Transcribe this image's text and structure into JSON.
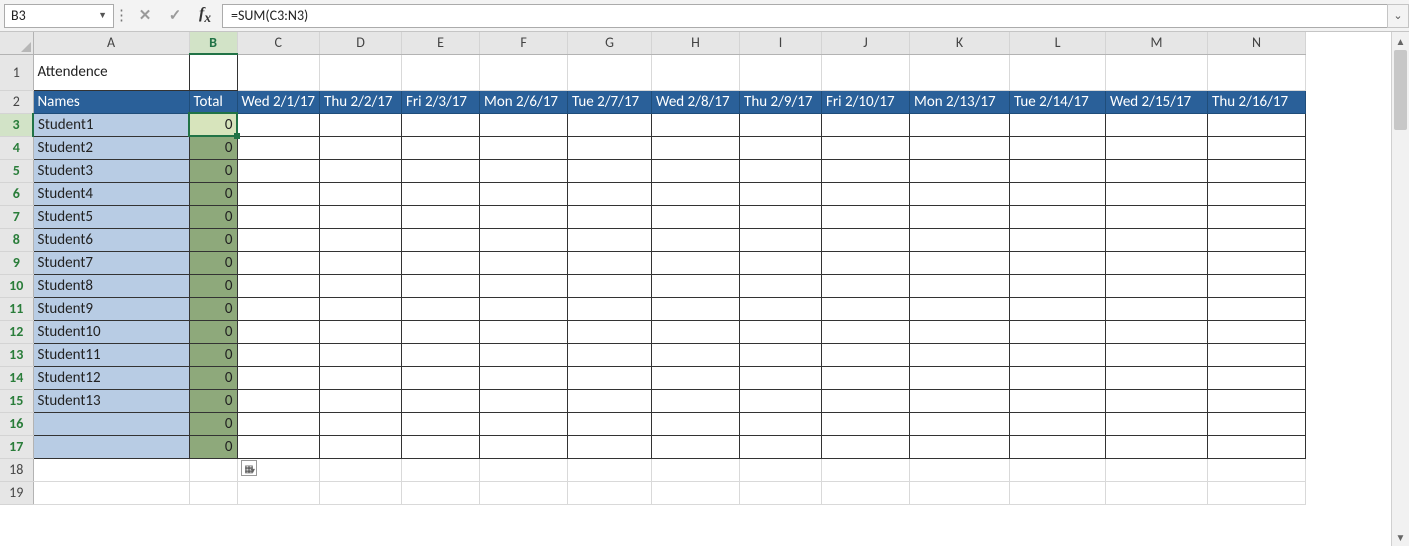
{
  "formula_bar": {
    "cell_ref": "B3",
    "formula": "=SUM(C3:N3)"
  },
  "columns": [
    "A",
    "B",
    "C",
    "D",
    "E",
    "F",
    "G",
    "H",
    "I",
    "J",
    "K",
    "L",
    "M",
    "N"
  ],
  "col_widths": [
    "cA",
    "cB",
    "cC",
    "cD",
    "cE",
    "cF",
    "cG",
    "cH",
    "cI",
    "cJ",
    "cK",
    "cL",
    "cM",
    "cN"
  ],
  "active": {
    "col": "B",
    "row": 3
  },
  "row1": {
    "title": "Attendence"
  },
  "row2": [
    "Names",
    "Total",
    "Wed 2/1/17",
    "Thu 2/2/17",
    "Fri 2/3/17",
    "Mon 2/6/17",
    "Tue 2/7/17",
    "Wed 2/8/17",
    "Thu 2/9/17",
    "Fri 2/10/17",
    "Mon 2/13/17",
    "Tue 2/14/17",
    "Wed 2/15/17",
    "Thu 2/16/17"
  ],
  "students": [
    {
      "name": "Student1",
      "total": 0
    },
    {
      "name": "Student2",
      "total": 0
    },
    {
      "name": "Student3",
      "total": 0
    },
    {
      "name": "Student4",
      "total": 0
    },
    {
      "name": "Student5",
      "total": 0
    },
    {
      "name": "Student6",
      "total": 0
    },
    {
      "name": "Student7",
      "total": 0
    },
    {
      "name": "Student8",
      "total": 0
    },
    {
      "name": "Student9",
      "total": 0
    },
    {
      "name": "Student10",
      "total": 0
    },
    {
      "name": "Student11",
      "total": 0
    },
    {
      "name": "Student12",
      "total": 0
    },
    {
      "name": "Student13",
      "total": 0
    },
    {
      "name": "",
      "total": 0
    },
    {
      "name": "",
      "total": 0
    }
  ],
  "empty_rows_after": [
    18,
    19
  ],
  "colors": {
    "header_bg": "#2a6099",
    "names_bg": "#b8cce4",
    "total_bg": "#8ea97b",
    "selection": "#217346"
  }
}
